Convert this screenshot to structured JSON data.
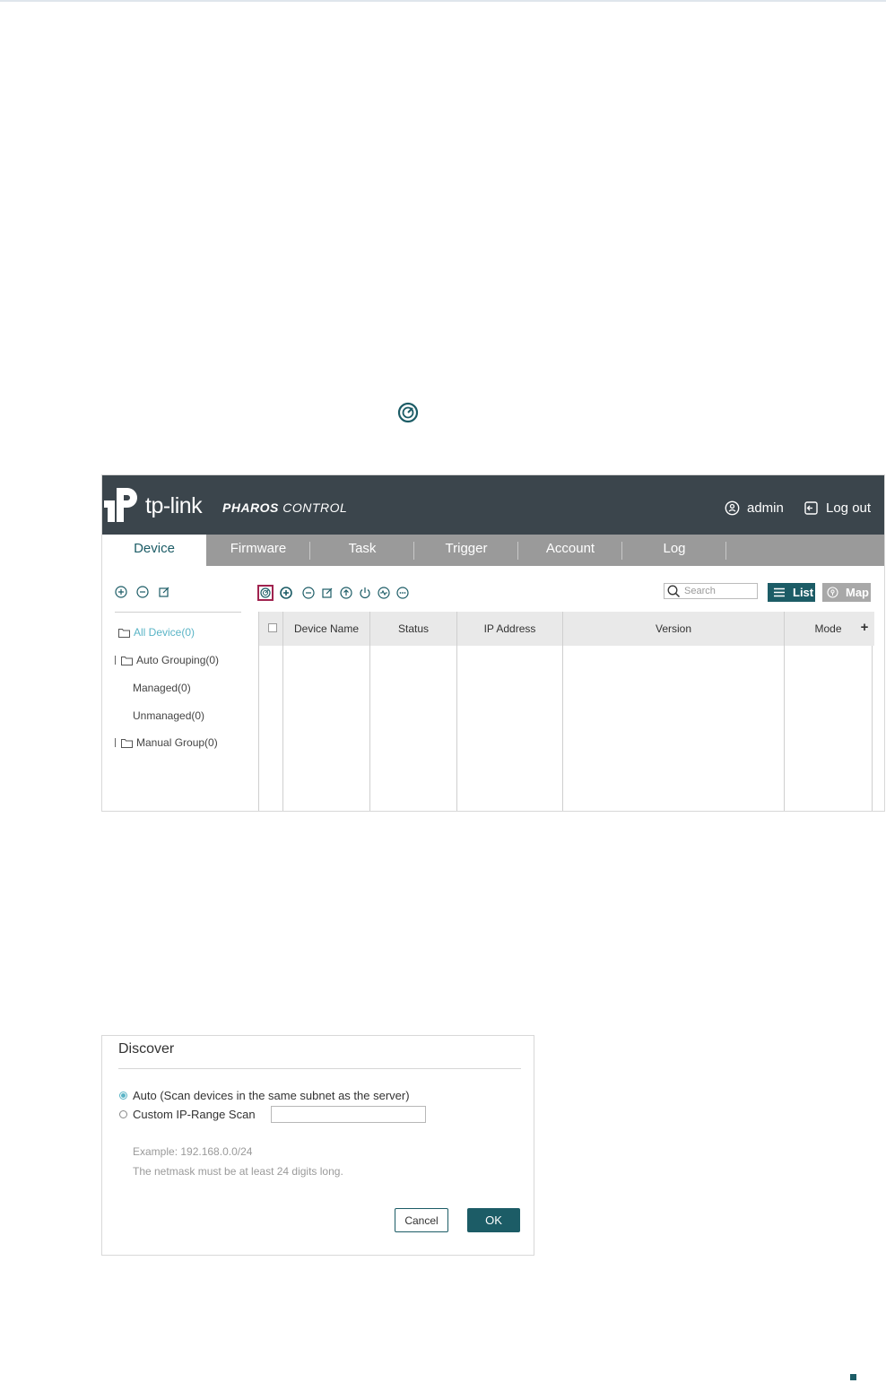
{
  "app": {
    "logo_text": "tp-link",
    "product_bold": "PHAROS",
    "product_rest": " CONTROL",
    "user": "admin",
    "logout": "Log out",
    "tabs": [
      "Device",
      "Firmware",
      "Task",
      "Trigger",
      "Account",
      "Log"
    ],
    "active_tab": "Device",
    "tree": [
      "All Device(0)",
      "Auto Grouping(0)",
      "Managed(0)",
      "Unmanaged(0)",
      "Manual Group(0)"
    ],
    "search_placeholder": "Search",
    "list_label": "List",
    "map_label": "Map",
    "columns": [
      "Device Name",
      "Status",
      "IP Address",
      "Version",
      "Mode"
    ],
    "add_column": "+"
  },
  "dialog": {
    "title": "Discover",
    "option_auto": "Auto (Scan devices in the same subnet as the server)",
    "option_custom": "Custom IP-Range Scan",
    "selected_option": "auto",
    "ip_range_value": "",
    "example": "Example: 192.168.0.0/24",
    "note": "The netmask must be at least 24 digits long.",
    "cancel": "Cancel",
    "ok": "OK"
  },
  "colors": {
    "brand": "#1c5c66",
    "header": "#3b454c",
    "tabbar": "#9a9a9a",
    "highlight": "#a0234f",
    "tree_selected": "#5ab4c6"
  }
}
